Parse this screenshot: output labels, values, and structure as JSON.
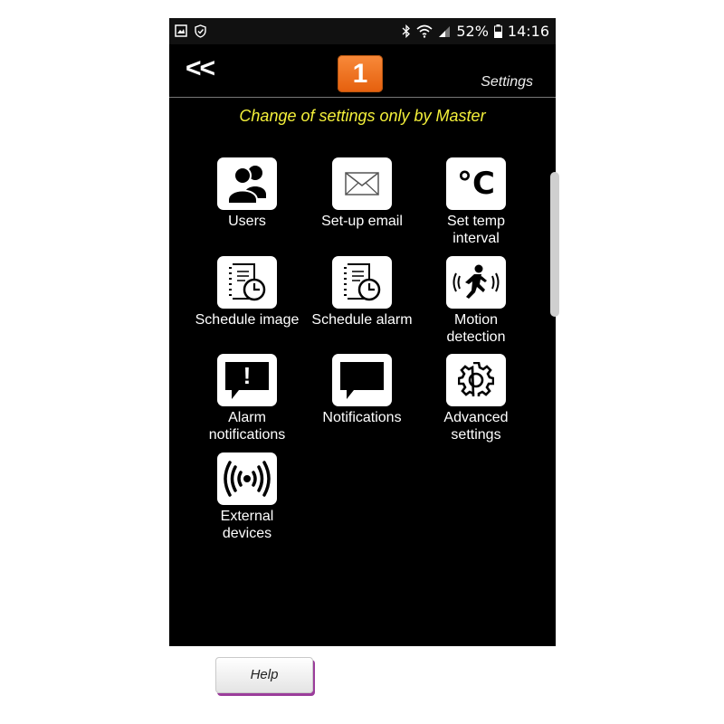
{
  "status_bar": {
    "battery": "52%",
    "time": "14:16"
  },
  "app_bar": {
    "back_label": "<<",
    "badge_number": "1",
    "title": "Settings"
  },
  "notice": "Change of settings only by Master",
  "tiles": [
    {
      "label": "Users",
      "icon": "users-icon"
    },
    {
      "label": "Set-up email",
      "icon": "envelope-icon"
    },
    {
      "label": "Set temp\ninterval",
      "icon": "celsius-icon",
      "icon_text": "°C"
    },
    {
      "label": "Schedule image",
      "icon": "schedule-clock-icon"
    },
    {
      "label": "Schedule alarm",
      "icon": "schedule-clock-icon"
    },
    {
      "label": "Motion\ndetection",
      "icon": "running-person-icon"
    },
    {
      "label": "Alarm\nnotifications",
      "icon": "alert-bubble-icon",
      "icon_text": "!"
    },
    {
      "label": "Notifications",
      "icon": "speech-bubble-icon"
    },
    {
      "label": "Advanced\nsettings",
      "icon": "gear-icon"
    },
    {
      "label": "External\ndevices",
      "icon": "radio-waves-icon"
    }
  ],
  "help_label": "Help",
  "colors": {
    "background": "#000000",
    "notice": "#f4f03a",
    "badge": "#ef6f1c",
    "help_shadow": "#9b3d9b"
  }
}
